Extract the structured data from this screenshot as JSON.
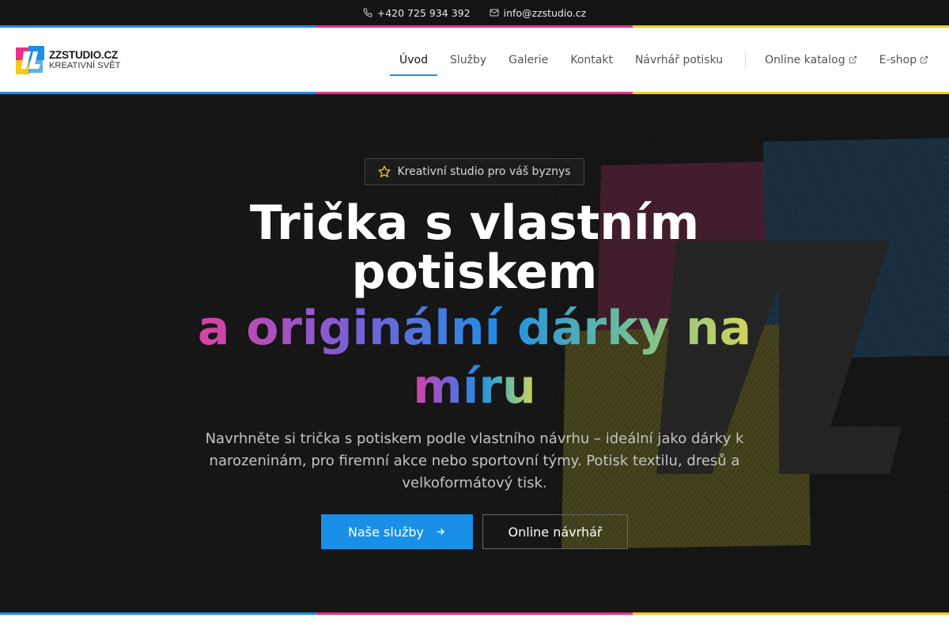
{
  "topbar": {
    "phone": "+420 725 934 392",
    "phone_icon": "phone-icon",
    "email": "info@zzstudio.cz",
    "email_icon": "mail-icon"
  },
  "brand_colors": {
    "blue": "#1e8fe6",
    "magenta": "#e8308c",
    "yellow": "#f2cc16",
    "dark": "#161616"
  },
  "logo": {
    "name": "ZZSTUDIO.CZ",
    "tagline": "KREATIVNÍ SVĚT"
  },
  "nav": {
    "items": [
      {
        "label": "Úvod",
        "active": true
      },
      {
        "label": "Služby"
      },
      {
        "label": "Galerie"
      },
      {
        "label": "Kontakt"
      },
      {
        "label": "Návrhář potisku"
      }
    ],
    "external": [
      {
        "label": "Online katalog",
        "icon": "external-link-icon"
      },
      {
        "label": "E-shop",
        "icon": "external-link-icon"
      }
    ]
  },
  "hero": {
    "badge": "Kreativní studio pro váš byznys",
    "badge_icon": "star-icon",
    "title_line1": "Trička s vlastním",
    "title_line2": "potiskem",
    "title_accent_line1": "a originální dárky na",
    "title_accent_line2": "míru",
    "lead": "Navrhněte si trička s potiskem podle vlastního návrhu – ideální jako dárky k narozeninám, pro firemní akce nebo sportovní týmy. Potisk textilu, dresů a velkoformátový tisk.",
    "primary_button": "Naše služby",
    "primary_icon": "arrow-right-icon",
    "secondary_button": "Online návrhář"
  }
}
